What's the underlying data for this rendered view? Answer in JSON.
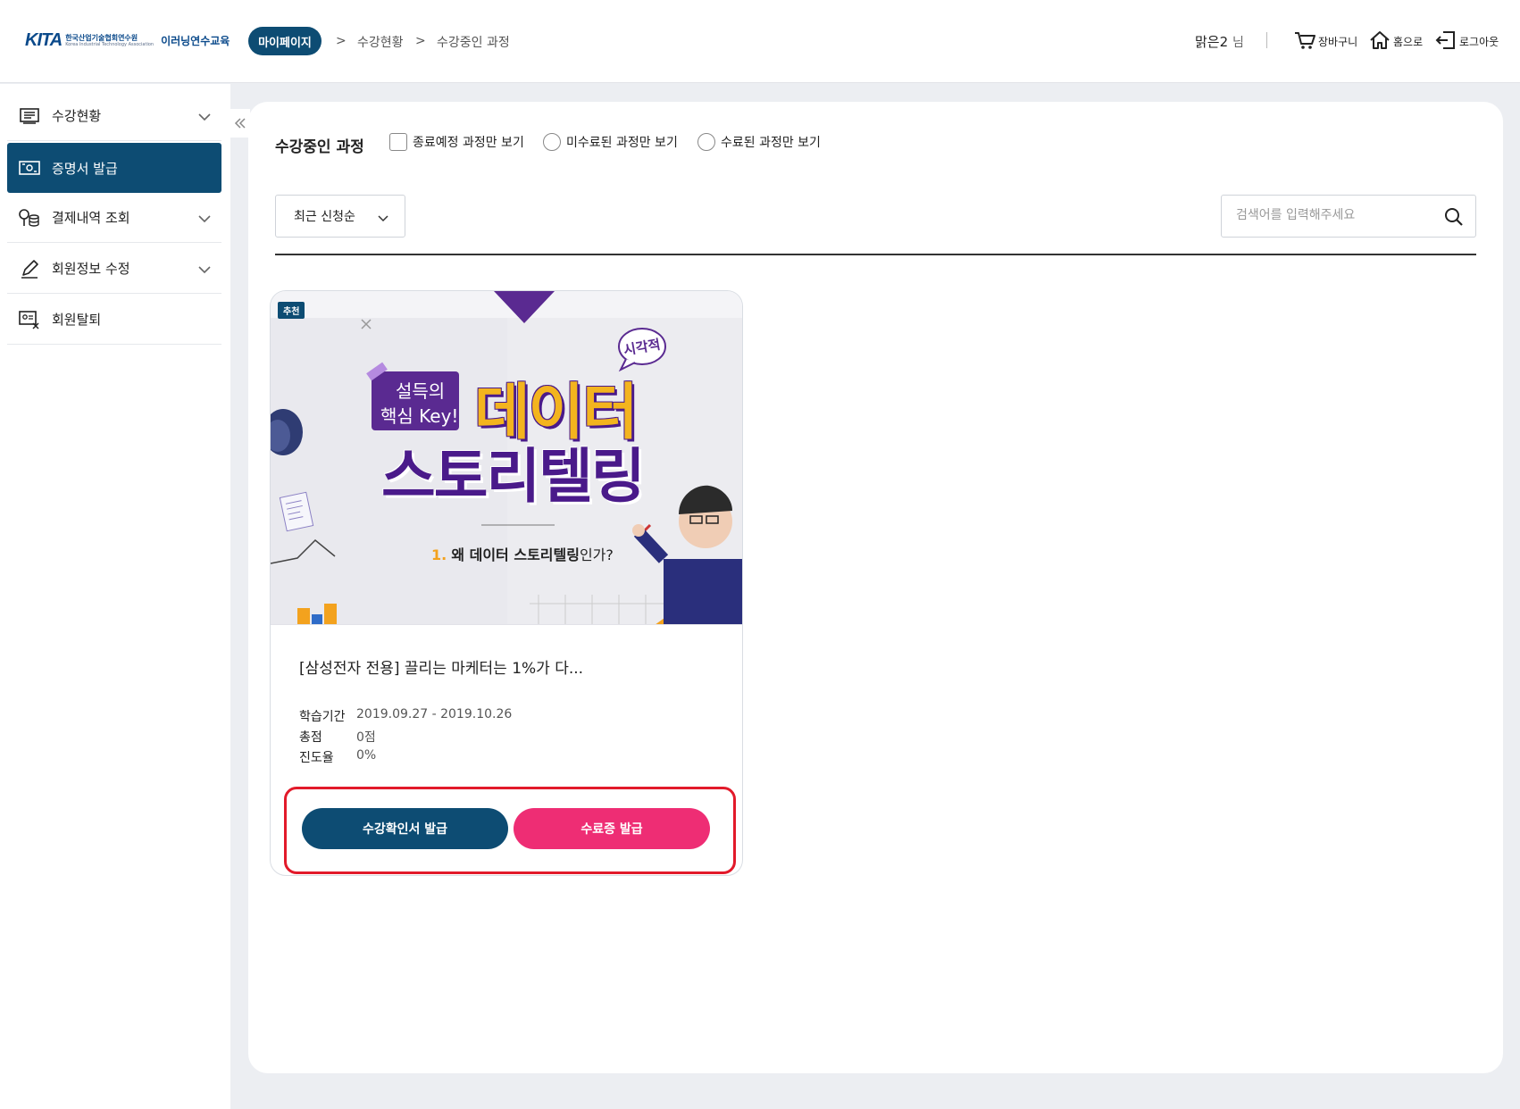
{
  "header": {
    "logo_mark": "KITA",
    "logo_ko": "한국산업기술협회연수원",
    "logo_en": "Korea Industrial Technology Association",
    "logo_title": "이러닝연수교육",
    "breadcrumb": [
      "마이페이지",
      "수강현황",
      "수강중인 과정"
    ],
    "user_name": "맑은2",
    "user_suffix": "님",
    "cart_label": "장바구니",
    "home_label": "홈으로",
    "logout_label": "로그아웃"
  },
  "sidebar": {
    "items": [
      {
        "label": "수강현황",
        "icon": "course-list-icon",
        "expandable": true
      },
      {
        "label": "증명서 발급",
        "icon": "certificate-icon",
        "active": true
      },
      {
        "label": "결제내역 조회",
        "icon": "payment-icon",
        "expandable": true
      },
      {
        "label": "회원정보 수정",
        "icon": "pencil-icon",
        "expandable": true
      },
      {
        "label": "회원탈퇴",
        "icon": "id-card-icon"
      }
    ],
    "collapse_icon": "double-chevron-left-icon"
  },
  "main": {
    "title": "수강중인 과정",
    "filters": [
      {
        "type": "checkbox",
        "label": "종료예정 과정만 보기"
      },
      {
        "type": "radio",
        "label": "미수료된 과정만 보기"
      },
      {
        "type": "radio",
        "label": "수료된 과정만 보기"
      }
    ],
    "sort_value": "최근 신청순",
    "search_placeholder": "검색어를 입력해주세요"
  },
  "card": {
    "badge": "추천",
    "thumb": {
      "tag_line1": "설득의",
      "tag_line2": "핵심 Key!",
      "headline1": "데이터",
      "headline2": "스토리텔링",
      "bubble": "시각적",
      "num": "1.",
      "subtitle_a": "왜 데이터 ",
      "subtitle_b": "스토리텔링",
      "subtitle_c": "인가?"
    },
    "title": "[삼성전자 전용] 끌리는 마케터는 1%가 다...",
    "period_label": "학습기간",
    "period_value": "2019.09.27 - 2019.10.26",
    "score_label": "총점",
    "score_value": "0점",
    "progress_label": "진도율",
    "progress_value": "0%",
    "btn_confirm": "수강확인서 발급",
    "btn_certificate": "수료증 발급"
  },
  "colors": {
    "navy": "#0d4c73",
    "pink": "#ee2d74",
    "highlight_border": "#e21a2a",
    "thumb_purple": "#4a1a8a",
    "thumb_yellow": "#f3b41e"
  }
}
